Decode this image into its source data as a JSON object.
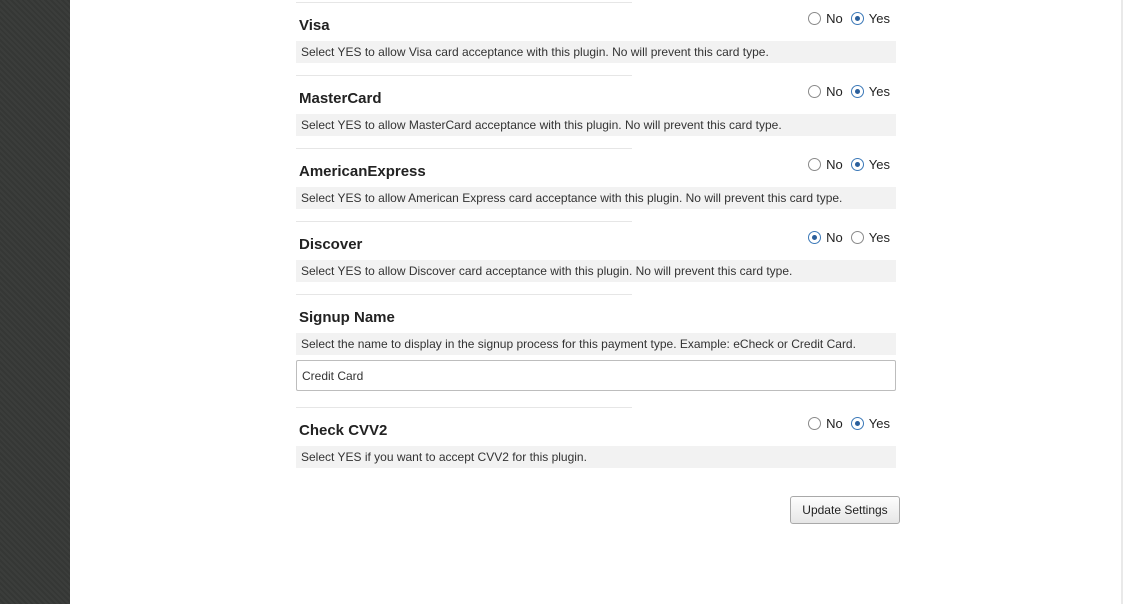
{
  "settings": {
    "visa": {
      "label": "Visa",
      "description": "Select YES to allow Visa card acceptance with this plugin. No will prevent this card type.",
      "options": [
        "No",
        "Yes"
      ],
      "selected": "Yes"
    },
    "mastercard": {
      "label": "MasterCard",
      "description": "Select YES to allow MasterCard acceptance with this plugin. No will prevent this card type.",
      "options": [
        "No",
        "Yes"
      ],
      "selected": "Yes"
    },
    "amex": {
      "label": "AmericanExpress",
      "description": "Select YES to allow American Express card acceptance with this plugin. No will prevent this card type.",
      "options": [
        "No",
        "Yes"
      ],
      "selected": "Yes"
    },
    "discover": {
      "label": "Discover",
      "description": "Select YES to allow Discover card acceptance with this plugin. No will prevent this card type.",
      "options": [
        "No",
        "Yes"
      ],
      "selected": "No"
    },
    "signup_name": {
      "label": "Signup Name",
      "description": "Select the name to display in the signup process for this payment type. Example: eCheck or Credit Card.",
      "value": "Credit Card"
    },
    "cvv2": {
      "label": "Check CVV2",
      "description": "Select YES if you want to accept CVV2 for this plugin.",
      "options": [
        "No",
        "Yes"
      ],
      "selected": "Yes"
    }
  },
  "update_button_label": "Update Settings",
  "colors": {
    "sidebar": "#3b3d3b",
    "description_bg": "#f2f2f2",
    "radio_checked": "#2a5f9c"
  }
}
